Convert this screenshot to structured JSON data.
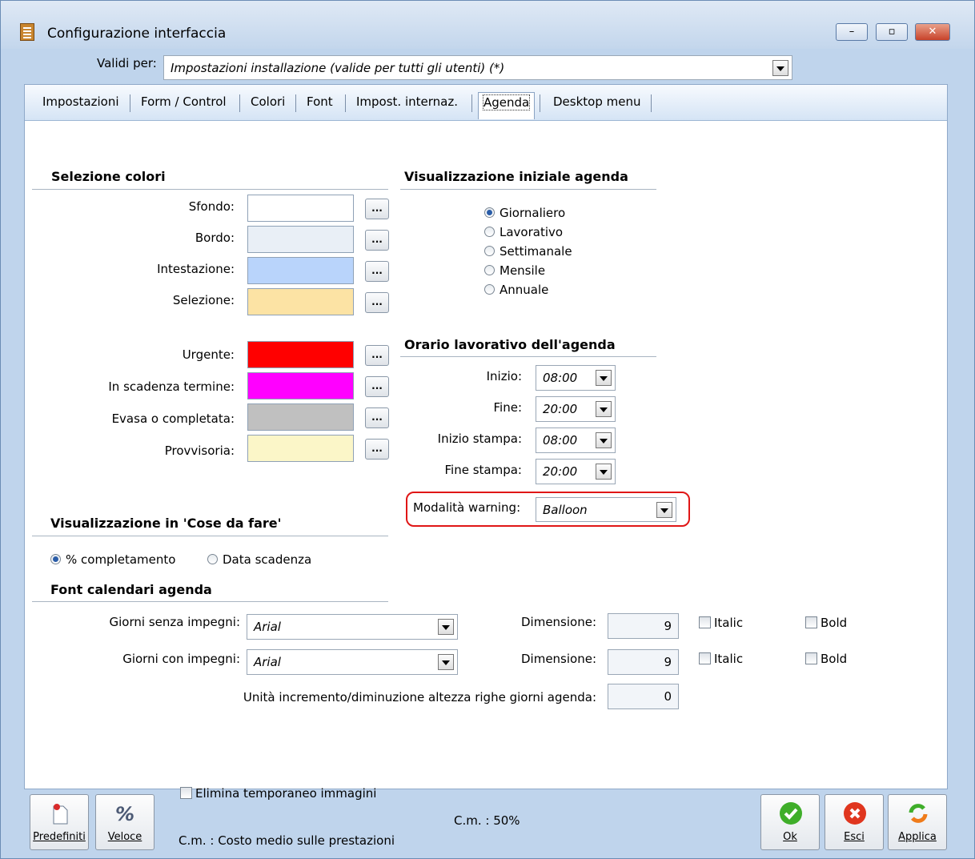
{
  "window": {
    "title": "Configurazione interfaccia",
    "minimize": "–",
    "maximize": "▫",
    "close": "✕"
  },
  "valid_for": {
    "label": "Validi per:",
    "value": "Impostazioni installazione (valide per tutti gli utenti) (*)"
  },
  "tabs": [
    "Impostazioni",
    "Form / Control",
    "Colori",
    "Font",
    "Impost. internaz.",
    "Agenda",
    "Desktop menu"
  ],
  "active_tab": "Agenda",
  "colors_section": {
    "title": "Selezione colori",
    "items": [
      {
        "label": "Sfondo:",
        "color": "#FFFFFF"
      },
      {
        "label": "Bordo:",
        "color": "#E9EFF6"
      },
      {
        "label": "Intestazione:",
        "color": "#B9D4FB"
      },
      {
        "label": "Selezione:",
        "color": "#FCE3A4"
      },
      {
        "label": "Urgente:",
        "color": "#FF0000"
      },
      {
        "label": "In scadenza termine:",
        "color": "#FF00FF"
      },
      {
        "label": "Evasa o completata:",
        "color": "#C0C0C0"
      },
      {
        "label": "Provvisoria:",
        "color": "#FBF6C8"
      }
    ],
    "button_label": "..."
  },
  "initial_view": {
    "title": "Visualizzazione iniziale agenda",
    "options": [
      "Giornaliero",
      "Lavorativo",
      "Settimanale",
      "Mensile",
      "Annuale"
    ],
    "selected": "Giornaliero"
  },
  "work_hours": {
    "title": "Orario lavorativo dell'agenda",
    "rows": [
      {
        "label": "Inizio:",
        "value": "08:00"
      },
      {
        "label": "Fine:",
        "value": "20:00"
      },
      {
        "label": "Inizio stampa:",
        "value": "08:00"
      },
      {
        "label": "Fine stampa:",
        "value": "20:00"
      }
    ],
    "warning_label": "Modalità warning:",
    "warning_value": "Balloon"
  },
  "todo_view": {
    "title": "Visualizzazione in 'Cose da fare'",
    "options": [
      "% completamento",
      "Data scadenza"
    ],
    "selected": "% completamento"
  },
  "fonts": {
    "title": "Font calendari agenda",
    "rows": [
      {
        "label": "Giorni senza impegni:",
        "font": "Arial",
        "size_label": "Dimensione:",
        "size": "9",
        "italic": "Italic",
        "bold": "Bold"
      },
      {
        "label": "Giorni con impegni:",
        "font": "Arial",
        "size_label": "Dimensione:",
        "size": "9",
        "italic": "Italic",
        "bold": "Bold"
      }
    ],
    "increment_label": "Unità incremento/diminuzione altezza righe giorni agenda:",
    "increment_value": "0"
  },
  "footer": {
    "default_btn": "Predefiniti",
    "fast_btn": "Veloce",
    "delete_temp": "Elimina temporaneo immagini",
    "cm_percent": "C.m. : 50%",
    "cm_note": "C.m. : Costo medio sulle prestazioni",
    "ok": "Ok",
    "exit": "Esci",
    "apply": "Applica"
  }
}
